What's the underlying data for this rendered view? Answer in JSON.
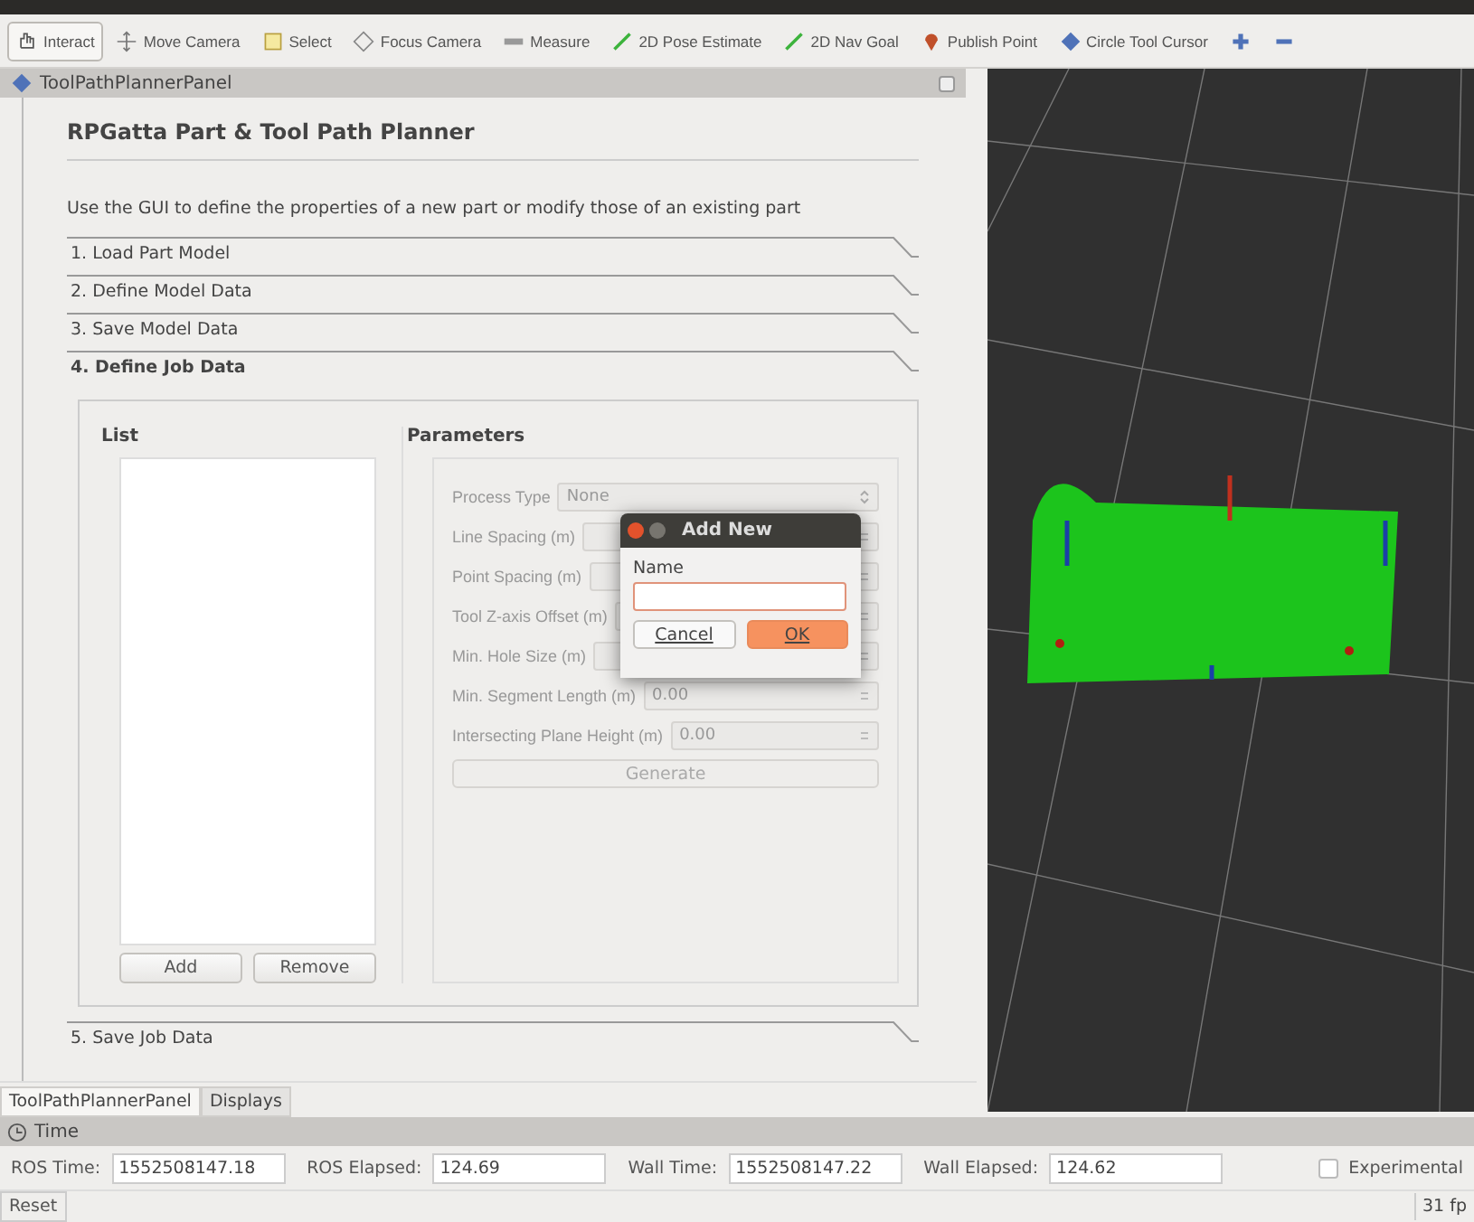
{
  "toolbar": [
    {
      "label": "Interact",
      "selected": true
    },
    {
      "label": "Move Camera",
      "selected": false
    },
    {
      "label": "Select",
      "selected": false
    },
    {
      "label": "Focus Camera",
      "selected": false
    },
    {
      "label": "Measure",
      "selected": false
    },
    {
      "label": "2D Pose Estimate",
      "selected": false
    },
    {
      "label": "2D Nav Goal",
      "selected": false
    },
    {
      "label": "Publish Point",
      "selected": false
    },
    {
      "label": "Circle Tool Cursor",
      "selected": false
    },
    {
      "selected": false
    },
    {
      "selected": false
    }
  ],
  "panel": {
    "title": "ToolPathPlannerPanel",
    "heading": "RPGatta Part & Tool Path Planner",
    "description": "Use the GUI to define the properties of a new part or modify those of an existing part",
    "steps": [
      {
        "label": "1. Load Part Model",
        "expanded": false
      },
      {
        "label": "2. Define Model Data",
        "expanded": false
      },
      {
        "label": "3. Save Model Data",
        "expanded": false
      },
      {
        "label": "4. Define Job Data",
        "expanded": true
      },
      {
        "label": "5. Save Job Data",
        "expanded": false
      }
    ],
    "list": {
      "title": "List",
      "buttons": [
        "Add",
        "Remove"
      ]
    },
    "parameters": {
      "title": "Parameters",
      "disabled": true,
      "rows": [
        {
          "label": "Process Type",
          "kind": "combo",
          "value": "None"
        },
        {
          "label": "Line Spacing (m)",
          "kind": "spin"
        },
        {
          "label": "Point Spacing (m)",
          "kind": "spin"
        },
        {
          "label": "Tool Z-axis Offset (m)",
          "kind": "spin"
        },
        {
          "label": "Min. Hole Size (m)",
          "kind": "spin"
        },
        {
          "label": "Min. Segment Length (m)",
          "kind": "spin",
          "value": "0.00"
        },
        {
          "label": "Intersecting Plane Height (m)",
          "kind": "spin",
          "value": "0.00"
        }
      ],
      "button": "Generate"
    }
  },
  "dialog": {
    "title": "Add New",
    "field_label": "Name",
    "buttons": [
      {
        "label": "Cancel",
        "kind": "normal"
      },
      {
        "label": "OK",
        "kind": "default"
      }
    ]
  },
  "dock_tabs": [
    {
      "label": "ToolPathPlannerPanel",
      "selected": true
    },
    {
      "label": "Displays",
      "selected": false
    }
  ],
  "time": {
    "title": "Time",
    "fields": [
      {
        "label": "ROS Time:",
        "value": "1552508147.18"
      },
      {
        "label": "ROS Elapsed:",
        "value": "124.69"
      },
      {
        "label": "Wall Time:",
        "value": "1552508147.22"
      },
      {
        "label": "Wall Elapsed:",
        "value": "124.62"
      }
    ],
    "experimental": {
      "label": "Experimental",
      "checked": false
    }
  },
  "status": {
    "reset": "Reset",
    "fps": "31 fp"
  }
}
